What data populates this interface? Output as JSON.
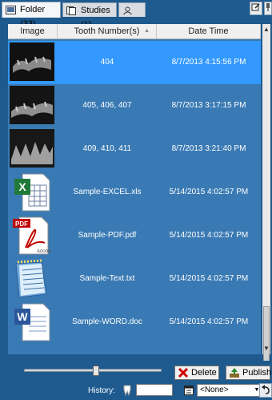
{
  "tabs": [
    {
      "label": "Folder (33)",
      "icon": "image-folder-icon",
      "active": true
    },
    {
      "label": "Studies (1)",
      "icon": "studies-icon",
      "active": false
    },
    {
      "label": "",
      "icon": "person-icon",
      "active": false
    }
  ],
  "columns": {
    "image": "Image",
    "tooth": "Tooth Number(s)",
    "date": "Date Time"
  },
  "rows": [
    {
      "thumb": "xray-thumbnail",
      "tooth": "404",
      "date": "8/7/2013 4:15:56 PM",
      "selected": true
    },
    {
      "thumb": "xray-thumbnail",
      "tooth": "405, 406, 407",
      "date": "8/7/2013 3:17:15 PM",
      "selected": false
    },
    {
      "thumb": "xray-thumbnail",
      "tooth": "409, 410, 411",
      "date": "8/7/2013 3:21:40 PM",
      "selected": false
    },
    {
      "thumb": "excel-file-icon",
      "tooth": "Sample-EXCEL.xls",
      "date": "5/14/2015 4:02:57 PM",
      "selected": false
    },
    {
      "thumb": "pdf-file-icon",
      "tooth": "Sample-PDF.pdf",
      "date": "5/14/2015 4:02:57 PM",
      "selected": false
    },
    {
      "thumb": "text-file-icon",
      "tooth": "Sample-Text.txt",
      "date": "5/14/2015 4:02:57 PM",
      "selected": false
    },
    {
      "thumb": "word-file-icon",
      "tooth": "Sample-WORD.doc",
      "date": "5/14/2015 4:02:57 PM",
      "selected": false
    }
  ],
  "buttons": {
    "delete": "Delete",
    "publish": "Publish"
  },
  "history": {
    "label": "History:",
    "value": "",
    "combo": "<None>"
  },
  "colors": {
    "background": "#1e5a8e",
    "list_bg": "#3a7ab4",
    "selected_row": "#3399ff"
  }
}
